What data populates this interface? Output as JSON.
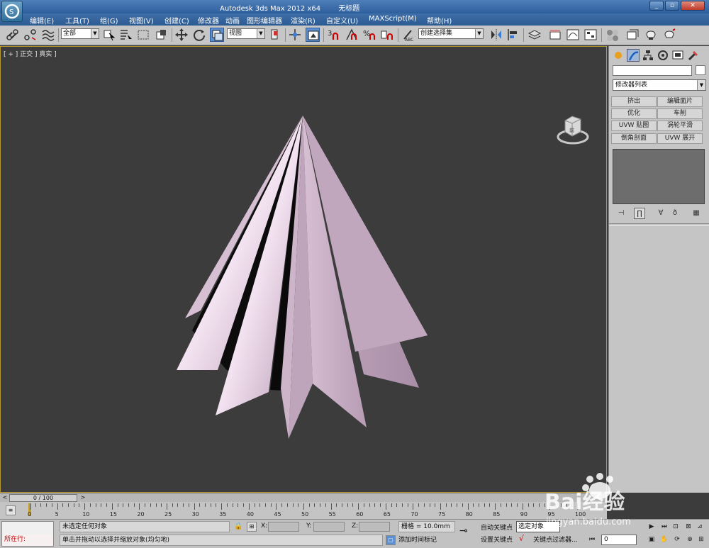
{
  "window": {
    "app_title": "Autodesk 3ds Max  2012 x64",
    "doc_title": "无标题"
  },
  "menu": [
    "编辑(E)",
    "工具(T)",
    "组(G)",
    "视图(V)",
    "创建(C)",
    "修改器",
    "动画",
    "图形编辑器",
    "渲染(R)",
    "自定义(U)",
    "MAXScript(M)",
    "帮助(H)"
  ],
  "toolbar": {
    "selection_filter": "全部",
    "reference_coord": "视图",
    "named_selection": "创建选择集"
  },
  "viewport": {
    "label": "[ + ] 正交 ] 真实 ]",
    "viewcube_face": "前"
  },
  "command_panel": {
    "modifier_list": "修改器列表",
    "modifier_buttons": [
      "挤出",
      "编辑面片",
      "优化",
      "车削",
      "UVW 贴图",
      "涡轮平滑",
      "倒角剖面",
      "UVW 展开"
    ]
  },
  "timeline": {
    "frame_display": "0 / 100",
    "tick_labels": [
      "0",
      "5",
      "10",
      "15",
      "20",
      "25",
      "30",
      "35",
      "40",
      "45",
      "50",
      "55",
      "60",
      "65",
      "70",
      "75",
      "80",
      "85",
      "90",
      "95",
      "100"
    ]
  },
  "status": {
    "listener_text": "所在行:",
    "selection_status": "未选定任何对象",
    "prompt": "单击并拖动以选择并缩放对象(均匀地)",
    "x_label": "X:",
    "y_label": "Y:",
    "z_label": "Z:",
    "grid": "栅格 = 10.0mm",
    "add_time_tag": "添加时间标记",
    "auto_key": "自动关键点",
    "set_key": "设置关键点",
    "selected_objects": "选定对象",
    "key_filters": "关键点过滤器...",
    "current_frame": "0"
  },
  "watermark": {
    "brand": "Bai经验",
    "url": "jingyan.baidu.com"
  },
  "colors": {
    "object_fill": "#d8c0d4",
    "viewport_bg": "#3c3c3c",
    "active_border": "#b49a30"
  }
}
